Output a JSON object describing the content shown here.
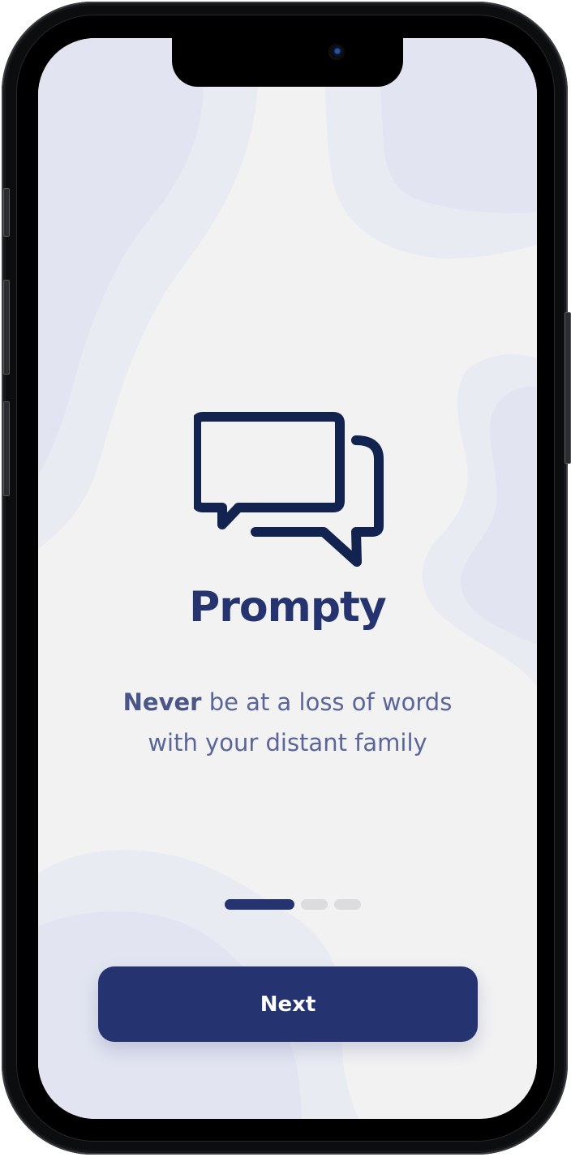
{
  "app": {
    "title": "Prompty",
    "logo_icon": "chat-bubbles-icon"
  },
  "onboarding": {
    "tagline_bold": "Never",
    "tagline_rest": " be at a loss of words",
    "tagline_line2": "with your distant family",
    "pager": {
      "total_pages": 3,
      "current_page": 1
    },
    "next_label": "Next"
  },
  "colors": {
    "primary": "#253470",
    "title": "#25346e",
    "tagline": "#5a6697",
    "background": "#f2f2f3",
    "blob": "#e3e6f1",
    "inactive_dot": "#dcdcdf"
  }
}
